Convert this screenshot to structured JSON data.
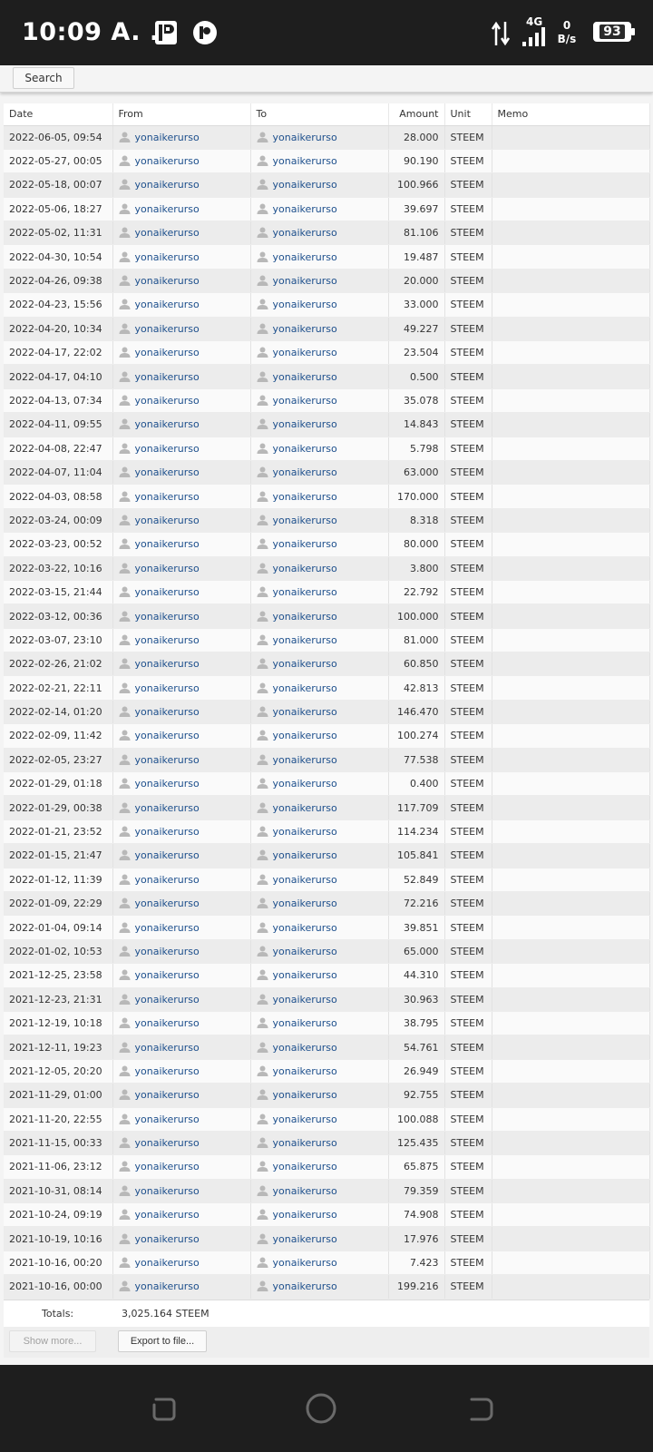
{
  "status_bar": {
    "time": "10:09 A. ...",
    "network_type": "4G",
    "speed_value": "0",
    "speed_unit": "B/s",
    "battery": "93"
  },
  "search": {
    "button_label": "Search"
  },
  "table": {
    "headers": {
      "date": "Date",
      "from": "From",
      "to": "To",
      "amount": "Amount",
      "unit": "Unit",
      "memo": "Memo"
    },
    "rows": [
      {
        "date": "2022-06-05, 09:54",
        "from": "yonaikerurso",
        "to": "yonaikerurso",
        "amount": "28.000",
        "unit": "STEEM",
        "memo": ""
      },
      {
        "date": "2022-05-27, 00:05",
        "from": "yonaikerurso",
        "to": "yonaikerurso",
        "amount": "90.190",
        "unit": "STEEM",
        "memo": ""
      },
      {
        "date": "2022-05-18, 00:07",
        "from": "yonaikerurso",
        "to": "yonaikerurso",
        "amount": "100.966",
        "unit": "STEEM",
        "memo": ""
      },
      {
        "date": "2022-05-06, 18:27",
        "from": "yonaikerurso",
        "to": "yonaikerurso",
        "amount": "39.697",
        "unit": "STEEM",
        "memo": ""
      },
      {
        "date": "2022-05-02, 11:31",
        "from": "yonaikerurso",
        "to": "yonaikerurso",
        "amount": "81.106",
        "unit": "STEEM",
        "memo": ""
      },
      {
        "date": "2022-04-30, 10:54",
        "from": "yonaikerurso",
        "to": "yonaikerurso",
        "amount": "19.487",
        "unit": "STEEM",
        "memo": ""
      },
      {
        "date": "2022-04-26, 09:38",
        "from": "yonaikerurso",
        "to": "yonaikerurso",
        "amount": "20.000",
        "unit": "STEEM",
        "memo": ""
      },
      {
        "date": "2022-04-23, 15:56",
        "from": "yonaikerurso",
        "to": "yonaikerurso",
        "amount": "33.000",
        "unit": "STEEM",
        "memo": ""
      },
      {
        "date": "2022-04-20, 10:34",
        "from": "yonaikerurso",
        "to": "yonaikerurso",
        "amount": "49.227",
        "unit": "STEEM",
        "memo": ""
      },
      {
        "date": "2022-04-17, 22:02",
        "from": "yonaikerurso",
        "to": "yonaikerurso",
        "amount": "23.504",
        "unit": "STEEM",
        "memo": ""
      },
      {
        "date": "2022-04-17, 04:10",
        "from": "yonaikerurso",
        "to": "yonaikerurso",
        "amount": "0.500",
        "unit": "STEEM",
        "memo": ""
      },
      {
        "date": "2022-04-13, 07:34",
        "from": "yonaikerurso",
        "to": "yonaikerurso",
        "amount": "35.078",
        "unit": "STEEM",
        "memo": ""
      },
      {
        "date": "2022-04-11, 09:55",
        "from": "yonaikerurso",
        "to": "yonaikerurso",
        "amount": "14.843",
        "unit": "STEEM",
        "memo": ""
      },
      {
        "date": "2022-04-08, 22:47",
        "from": "yonaikerurso",
        "to": "yonaikerurso",
        "amount": "5.798",
        "unit": "STEEM",
        "memo": ""
      },
      {
        "date": "2022-04-07, 11:04",
        "from": "yonaikerurso",
        "to": "yonaikerurso",
        "amount": "63.000",
        "unit": "STEEM",
        "memo": ""
      },
      {
        "date": "2022-04-03, 08:58",
        "from": "yonaikerurso",
        "to": "yonaikerurso",
        "amount": "170.000",
        "unit": "STEEM",
        "memo": ""
      },
      {
        "date": "2022-03-24, 00:09",
        "from": "yonaikerurso",
        "to": "yonaikerurso",
        "amount": "8.318",
        "unit": "STEEM",
        "memo": ""
      },
      {
        "date": "2022-03-23, 00:52",
        "from": "yonaikerurso",
        "to": "yonaikerurso",
        "amount": "80.000",
        "unit": "STEEM",
        "memo": ""
      },
      {
        "date": "2022-03-22, 10:16",
        "from": "yonaikerurso",
        "to": "yonaikerurso",
        "amount": "3.800",
        "unit": "STEEM",
        "memo": ""
      },
      {
        "date": "2022-03-15, 21:44",
        "from": "yonaikerurso",
        "to": "yonaikerurso",
        "amount": "22.792",
        "unit": "STEEM",
        "memo": ""
      },
      {
        "date": "2022-03-12, 00:36",
        "from": "yonaikerurso",
        "to": "yonaikerurso",
        "amount": "100.000",
        "unit": "STEEM",
        "memo": ""
      },
      {
        "date": "2022-03-07, 23:10",
        "from": "yonaikerurso",
        "to": "yonaikerurso",
        "amount": "81.000",
        "unit": "STEEM",
        "memo": ""
      },
      {
        "date": "2022-02-26, 21:02",
        "from": "yonaikerurso",
        "to": "yonaikerurso",
        "amount": "60.850",
        "unit": "STEEM",
        "memo": ""
      },
      {
        "date": "2022-02-21, 22:11",
        "from": "yonaikerurso",
        "to": "yonaikerurso",
        "amount": "42.813",
        "unit": "STEEM",
        "memo": ""
      },
      {
        "date": "2022-02-14, 01:20",
        "from": "yonaikerurso",
        "to": "yonaikerurso",
        "amount": "146.470",
        "unit": "STEEM",
        "memo": ""
      },
      {
        "date": "2022-02-09, 11:42",
        "from": "yonaikerurso",
        "to": "yonaikerurso",
        "amount": "100.274",
        "unit": "STEEM",
        "memo": ""
      },
      {
        "date": "2022-02-05, 23:27",
        "from": "yonaikerurso",
        "to": "yonaikerurso",
        "amount": "77.538",
        "unit": "STEEM",
        "memo": ""
      },
      {
        "date": "2022-01-29, 01:18",
        "from": "yonaikerurso",
        "to": "yonaikerurso",
        "amount": "0.400",
        "unit": "STEEM",
        "memo": ""
      },
      {
        "date": "2022-01-29, 00:38",
        "from": "yonaikerurso",
        "to": "yonaikerurso",
        "amount": "117.709",
        "unit": "STEEM",
        "memo": ""
      },
      {
        "date": "2022-01-21, 23:52",
        "from": "yonaikerurso",
        "to": "yonaikerurso",
        "amount": "114.234",
        "unit": "STEEM",
        "memo": ""
      },
      {
        "date": "2022-01-15, 21:47",
        "from": "yonaikerurso",
        "to": "yonaikerurso",
        "amount": "105.841",
        "unit": "STEEM",
        "memo": ""
      },
      {
        "date": "2022-01-12, 11:39",
        "from": "yonaikerurso",
        "to": "yonaikerurso",
        "amount": "52.849",
        "unit": "STEEM",
        "memo": ""
      },
      {
        "date": "2022-01-09, 22:29",
        "from": "yonaikerurso",
        "to": "yonaikerurso",
        "amount": "72.216",
        "unit": "STEEM",
        "memo": ""
      },
      {
        "date": "2022-01-04, 09:14",
        "from": "yonaikerurso",
        "to": "yonaikerurso",
        "amount": "39.851",
        "unit": "STEEM",
        "memo": ""
      },
      {
        "date": "2022-01-02, 10:53",
        "from": "yonaikerurso",
        "to": "yonaikerurso",
        "amount": "65.000",
        "unit": "STEEM",
        "memo": ""
      },
      {
        "date": "2021-12-25, 23:58",
        "from": "yonaikerurso",
        "to": "yonaikerurso",
        "amount": "44.310",
        "unit": "STEEM",
        "memo": ""
      },
      {
        "date": "2021-12-23, 21:31",
        "from": "yonaikerurso",
        "to": "yonaikerurso",
        "amount": "30.963",
        "unit": "STEEM",
        "memo": ""
      },
      {
        "date": "2021-12-19, 10:18",
        "from": "yonaikerurso",
        "to": "yonaikerurso",
        "amount": "38.795",
        "unit": "STEEM",
        "memo": ""
      },
      {
        "date": "2021-12-11, 19:23",
        "from": "yonaikerurso",
        "to": "yonaikerurso",
        "amount": "54.761",
        "unit": "STEEM",
        "memo": ""
      },
      {
        "date": "2021-12-05, 20:20",
        "from": "yonaikerurso",
        "to": "yonaikerurso",
        "amount": "26.949",
        "unit": "STEEM",
        "memo": ""
      },
      {
        "date": "2021-11-29, 01:00",
        "from": "yonaikerurso",
        "to": "yonaikerurso",
        "amount": "92.755",
        "unit": "STEEM",
        "memo": ""
      },
      {
        "date": "2021-11-20, 22:55",
        "from": "yonaikerurso",
        "to": "yonaikerurso",
        "amount": "100.088",
        "unit": "STEEM",
        "memo": ""
      },
      {
        "date": "2021-11-15, 00:33",
        "from": "yonaikerurso",
        "to": "yonaikerurso",
        "amount": "125.435",
        "unit": "STEEM",
        "memo": ""
      },
      {
        "date": "2021-11-06, 23:12",
        "from": "yonaikerurso",
        "to": "yonaikerurso",
        "amount": "65.875",
        "unit": "STEEM",
        "memo": ""
      },
      {
        "date": "2021-10-31, 08:14",
        "from": "yonaikerurso",
        "to": "yonaikerurso",
        "amount": "79.359",
        "unit": "STEEM",
        "memo": ""
      },
      {
        "date": "2021-10-24, 09:19",
        "from": "yonaikerurso",
        "to": "yonaikerurso",
        "amount": "74.908",
        "unit": "STEEM",
        "memo": ""
      },
      {
        "date": "2021-10-19, 10:16",
        "from": "yonaikerurso",
        "to": "yonaikerurso",
        "amount": "17.976",
        "unit": "STEEM",
        "memo": ""
      },
      {
        "date": "2021-10-16, 00:20",
        "from": "yonaikerurso",
        "to": "yonaikerurso",
        "amount": "7.423",
        "unit": "STEEM",
        "memo": ""
      },
      {
        "date": "2021-10-16, 00:00",
        "from": "yonaikerurso",
        "to": "yonaikerurso",
        "amount": "199.216",
        "unit": "STEEM",
        "memo": ""
      }
    ]
  },
  "totals": {
    "label": "Totals:",
    "value": "3,025.164 STEEM"
  },
  "actions": {
    "show_more_label": "Show more...",
    "export_label": "Export to file..."
  },
  "icons": {
    "user": "user-icon",
    "nav_recent": "recent-apps-icon",
    "nav_home": "home-icon",
    "nav_back": "back-icon"
  },
  "colors": {
    "link": "#1d4f8c",
    "row_odd": "#ececec",
    "row_even": "#fafafa",
    "system_bar": "#1e1e1e"
  }
}
